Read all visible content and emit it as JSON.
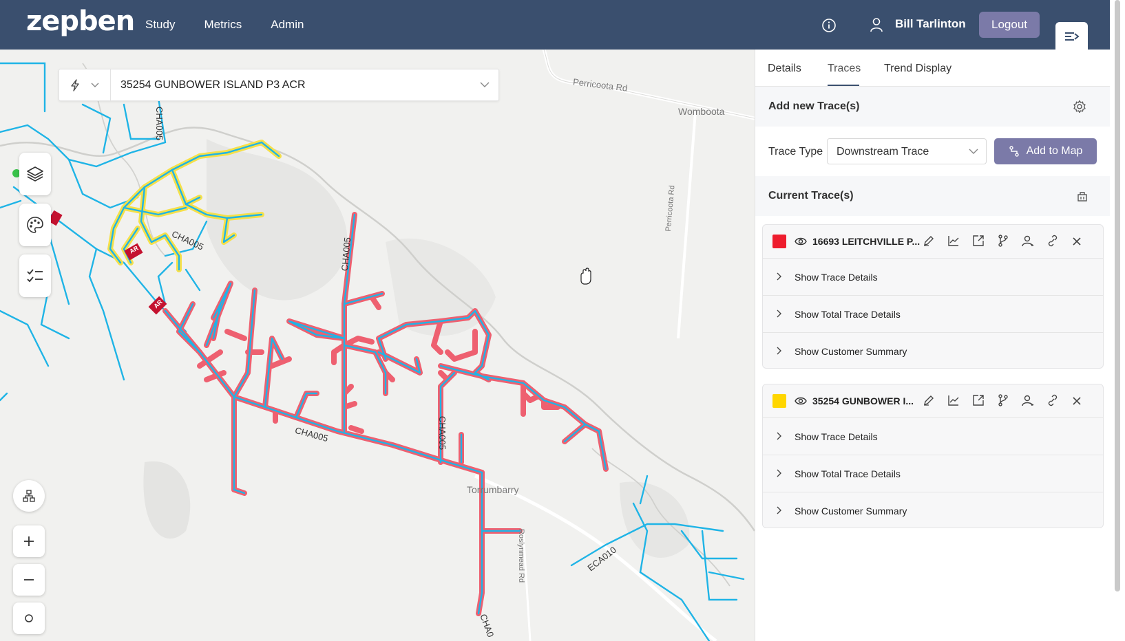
{
  "header": {
    "logo": "zepben",
    "nav": [
      "Study",
      "Metrics",
      "Admin"
    ],
    "user_name": "Bill Tarlinton",
    "logout_label": "Logout"
  },
  "map": {
    "feeder_value": "35254 GUNBOWER ISLAND P3 ACR",
    "labels": {
      "road1": "Perricoota Rd",
      "town": "Womboota",
      "road2": "Perricoota Rd",
      "town2": "Torrumbarry",
      "road3": "Roslynmead Rd",
      "cha1": "CHA005",
      "cha2": "CHA005",
      "cha3": "CHA005",
      "cha4": "CHA005",
      "cha5": "CHA005",
      "cha6": "CHA0",
      "eca": "ECA010",
      "ar": "AR"
    }
  },
  "sidebar": {
    "tabs": [
      "Details",
      "Traces",
      "Trend Display"
    ],
    "active_tab": "Traces",
    "add_title": "Add new Trace(s)",
    "trace_type_label": "Trace Type",
    "trace_type_value": "Downstream Trace",
    "add_button": "Add to Map",
    "current_title": "Current Trace(s)",
    "traces": [
      {
        "name": "16693 LEITCHVILLE P...",
        "color": "#ee1c2d",
        "rows": [
          "Show Trace Details",
          "Show Total Trace Details",
          "Show Customer Summary"
        ]
      },
      {
        "name": "35254 GUNBOWER I...",
        "color": "#ffd600",
        "rows": [
          "Show Trace Details",
          "Show Total Trace Details",
          "Show Customer Summary"
        ]
      }
    ]
  },
  "colors": {
    "header_bg": "#3a4f6e",
    "accent": "#7b7aa8",
    "network_line": "#1fb4e6",
    "trace_red": "#ee6070",
    "trace_yellow": "#f5e04a"
  }
}
